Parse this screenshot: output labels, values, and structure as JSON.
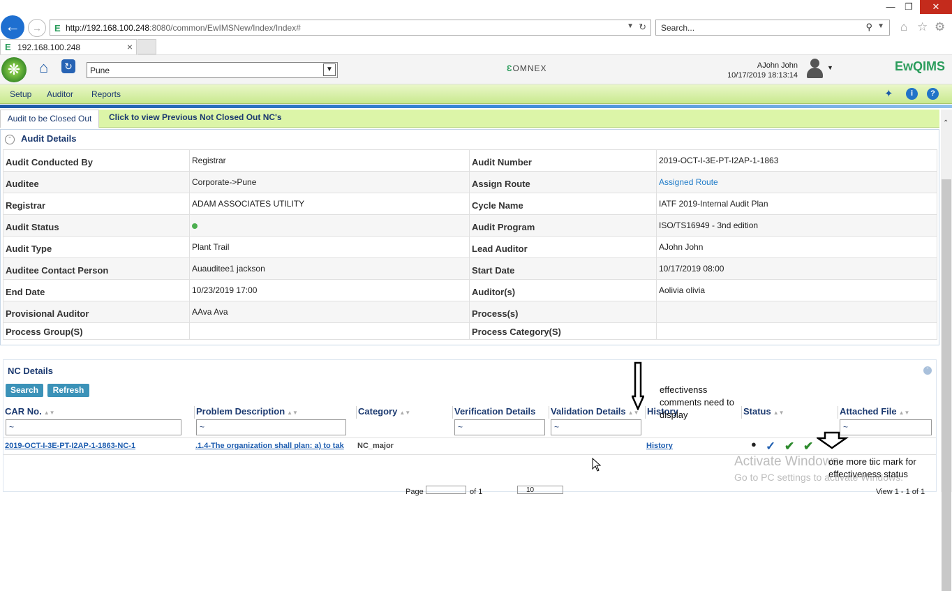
{
  "browser": {
    "url_host": "http://192.168.100.248",
    "url_rest": ":8080/common/EwIMSNew/Index/Index#",
    "search_placeholder": "Search...",
    "tab_title": "192.168.100.248"
  },
  "header": {
    "location": "Pune",
    "omnex_logo": "OMNEX",
    "user_name": "AJohn John",
    "timestamp": "10/17/2019 18:13:14",
    "brand_logo": "EwQIMS"
  },
  "menu": {
    "items": [
      "Setup",
      "Auditor",
      "Reports"
    ]
  },
  "subtabs": {
    "active": "Audit to be Closed Out",
    "other": "Click to view Previous Not Closed Out NC's"
  },
  "audit_details": {
    "title": "Audit Details",
    "rows": [
      {
        "l1": "Audit Conducted By",
        "v1": "Registrar",
        "l2": "Audit Number",
        "v2": "2019-OCT-I-3E-PT-I2AP-1-1863"
      },
      {
        "l1": "Auditee",
        "v1": "Corporate->Pune",
        "l2": "Assign Route",
        "v2": "Assigned Route"
      },
      {
        "l1": "Registrar",
        "v1": "ADAM ASSOCIATES UTILITY",
        "l2": "Cycle Name",
        "v2": "IATF 2019-Internal Audit Plan"
      },
      {
        "l1": "Audit Status",
        "v1": "",
        "l2": "Audit Program",
        "v2": "ISO/TS16949 - 3nd edition"
      },
      {
        "l1": "Audit Type",
        "v1": "Plant Trail",
        "l2": "Lead Auditor",
        "v2": "AJohn John"
      },
      {
        "l1": "Auditee Contact Person",
        "v1": "Auauditee1 jackson",
        "l2": "Start Date",
        "v2": "10/17/2019 08:00"
      },
      {
        "l1": "End Date",
        "v1": "10/23/2019 17:00",
        "l2": "Auditor(s)",
        "v2": "Aolivia olivia"
      },
      {
        "l1": "Provisional Auditor",
        "v1": "AAva Ava",
        "l2": "Process(s)",
        "v2": ""
      },
      {
        "l1": "Process Group(S)",
        "v1": "",
        "l2": "Process Category(S)",
        "v2": ""
      }
    ]
  },
  "nc_details": {
    "title": "NC Details",
    "search_label": "Search",
    "refresh_label": "Refresh",
    "columns": [
      "CAR No.",
      "Problem Description",
      "Category",
      "Verification Details",
      "Validation Details",
      "History",
      "Status",
      "Attached File"
    ],
    "filter_value": "~",
    "row": {
      "car_no": "2019-OCT-I-3E-PT-I2AP-1-1863-NC-1",
      "problem": ".1.4-The organization shall plan: a) to tak",
      "category": "NC_major",
      "verification": "",
      "validation": "",
      "history": "History"
    },
    "pager": {
      "page_label": "Page",
      "of_label": "of 1",
      "page_size": "10",
      "view_text": "View 1 - 1 of 1"
    }
  },
  "annotations": {
    "note1": "effectivenss comments need to display",
    "note2": "one more tiic mark for effectiveness status"
  },
  "watermark": {
    "line1": "Activate Windows",
    "line2": "Go to PC settings to activate Windows."
  },
  "colors": {
    "menu_green": "#c9e98f",
    "header_blue": "#1c3a70",
    "status_green": "#4caf50",
    "link_blue": "#1f7bc8"
  }
}
